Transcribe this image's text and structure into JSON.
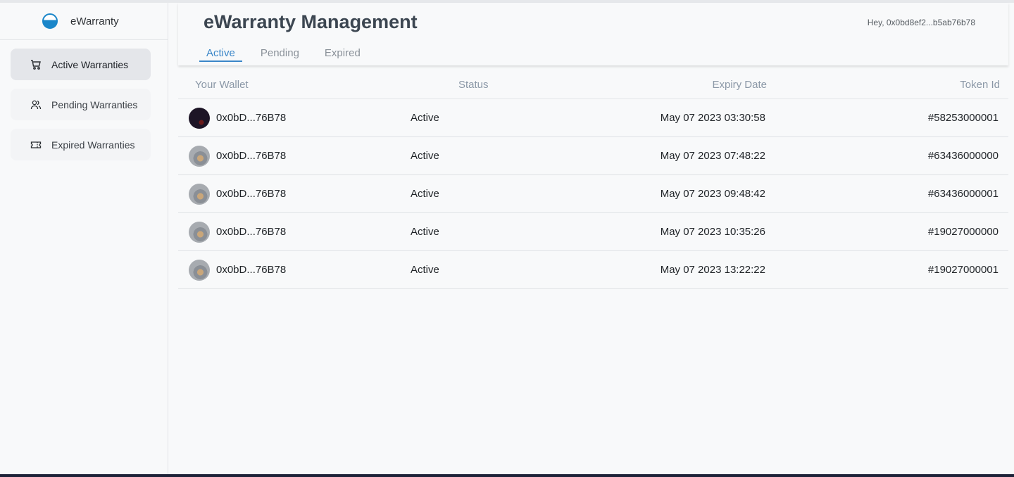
{
  "sidebar": {
    "brand": "eWarranty",
    "items": [
      {
        "label": "Active Warranties",
        "icon": "cart-icon",
        "active": true
      },
      {
        "label": "Pending Warranties",
        "icon": "users-icon",
        "active": false
      },
      {
        "label": "Expired Warranties",
        "icon": "ticket-icon",
        "active": false
      }
    ]
  },
  "header": {
    "title": "eWarranty Management",
    "greeting": "Hey, 0x0bd8ef2...b5ab76b78",
    "tabs": [
      "Active",
      "Pending",
      "Expired"
    ],
    "active_tab": "Active"
  },
  "table": {
    "columns": [
      "Your Wallet",
      "Status",
      "Expiry Date",
      "Token Id"
    ],
    "rows": [
      {
        "wallet": "0x0bD...76B78",
        "status": "Active",
        "expiry": "May 07 2023 03:30:58",
        "token": "#58253000001"
      },
      {
        "wallet": "0x0bD...76B78",
        "status": "Active",
        "expiry": "May 07 2023 07:48:22",
        "token": "#63436000000"
      },
      {
        "wallet": "0x0bD...76B78",
        "status": "Active",
        "expiry": "May 07 2023 09:48:42",
        "token": "#63436000001"
      },
      {
        "wallet": "0x0bD...76B78",
        "status": "Active",
        "expiry": "May 07 2023 10:35:26",
        "token": "#19027000000"
      },
      {
        "wallet": "0x0bD...76B78",
        "status": "Active",
        "expiry": "May 07 2023 13:22:22",
        "token": "#19027000001"
      }
    ]
  },
  "colors": {
    "accent": "#3a86c8",
    "brand": "#1a86c9",
    "header_text": "#8b98a7"
  }
}
